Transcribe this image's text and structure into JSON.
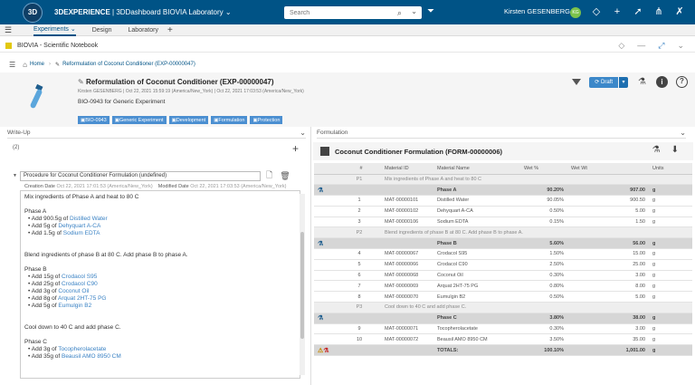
{
  "topbar": {
    "brand_bold": "3DEXPERIENCE",
    "brand_rest": " | 3DDashboard  BIOVIA Laboratory",
    "brand_chevron": "⌄",
    "search_placeholder": "Search",
    "user_name": "Kirsten GESENBERG",
    "user_initials": "KG",
    "bg_color": "#005386"
  },
  "tabs": [
    {
      "label": "Experiments ⌄",
      "active": true
    },
    {
      "label": "Design",
      "active": false
    },
    {
      "label": "Laboratory",
      "active": false
    }
  ],
  "app": {
    "name": "BIOVIA - Scientific Notebook"
  },
  "breadcrumb": {
    "home": "Home",
    "current": "Reformulation of Coconut Conditioner (EXP-00000047)"
  },
  "experiment": {
    "title": "Reformulation of Coconut Conditioner (EXP-00000047)",
    "meta": "Kirsten GESENBERG  |  Oct 22, 2021 15:59:19 (America/New_York)  |  Oct 22, 2021 17:03:53 (America/New_York)",
    "description": "BIO-0943 for Generic Experiment",
    "chips": [
      "BIO-0943",
      "Generic Experiment",
      "Development",
      "Formulation",
      "Protection"
    ],
    "status": "Draft"
  },
  "left_panel": {
    "header": "Write-Up",
    "count": "(2)",
    "procedure_title": "Procedure for Coconut Conditioner Formulation (undefined)",
    "creation_label": "Creation Date",
    "creation_value": "Oct 22, 2021 17:01:53 (America/New_York)",
    "modified_label": "Modified Date",
    "modified_value": "Oct 22, 2021 17:03:53 (America/New_York)",
    "editor": {
      "p1": "Mix ingredients of Phase A and heat to 80 C",
      "phaseA": "Phase A",
      "a_items": [
        {
          "pre": "Add 900.5g of ",
          "link": "Distilled Water"
        },
        {
          "pre": "Add 5g of ",
          "link": "Dehyquart A-CA"
        },
        {
          "pre": "Add 1.5g of ",
          "link": "Sodium EDTA"
        }
      ],
      "p2": "Blend ingredients of phase B at 80 C. Add phase B to phase A.",
      "phaseB": "Phase B",
      "b_items": [
        {
          "pre": "Add 15g of ",
          "link": "Crodacol S95"
        },
        {
          "pre": "Add 25g of ",
          "link": "Crodacol C90"
        },
        {
          "pre": "Add 3g of ",
          "link": "Coconut Oil"
        },
        {
          "pre": "Add 8g of ",
          "link": "Arquat 2HT-75 PG"
        },
        {
          "pre": "Add 5g of ",
          "link": "Eumulgin B2"
        }
      ],
      "p3": "Cool down to 40 C and add phase C.",
      "phaseC": "Phase C",
      "c_items": [
        {
          "pre": "Add 3g of ",
          "link": "Tocopherolacetate"
        },
        {
          "pre": "Add 35g of ",
          "link": "Beausil AMO 8950 CM"
        }
      ]
    }
  },
  "right_panel": {
    "header": "Formulation",
    "form_title": "Coconut Conditioner Formulation (FORM-00000006)",
    "columns": [
      "#",
      "Material ID",
      "Material Name",
      "Wet %",
      "Wet Wt",
      "Units"
    ],
    "rows": [
      {
        "kind": "step",
        "num": "P1",
        "text": "Mix ingredients of Phase A and heat to 80 C"
      },
      {
        "kind": "phase",
        "name": "Phase A",
        "pct": "90.20%",
        "wt": "907.00",
        "unit": "g"
      },
      {
        "kind": "item",
        "num": "1",
        "id": "MAT-00000101",
        "name": "Distilled Water",
        "pct": "90.05%",
        "wt": "900.50",
        "unit": "g"
      },
      {
        "kind": "item",
        "num": "2",
        "id": "MAT-00000102",
        "name": "Dehyquart A-CA",
        "pct": "0.50%",
        "wt": "5.00",
        "unit": "g"
      },
      {
        "kind": "item",
        "num": "3",
        "id": "MAT-00000106",
        "name": "Sodium EDTA",
        "pct": "0.15%",
        "wt": "1.50",
        "unit": "g"
      },
      {
        "kind": "step",
        "num": "P2",
        "text": "Blend ingredients of phase B at 80 C. Add phase B to phase A."
      },
      {
        "kind": "phase",
        "name": "Phase B",
        "pct": "5.60%",
        "wt": "56.00",
        "unit": "g"
      },
      {
        "kind": "item",
        "num": "4",
        "id": "MAT-00000067",
        "name": "Crodacol S95",
        "pct": "1.50%",
        "wt": "15.00",
        "unit": "g"
      },
      {
        "kind": "item",
        "num": "5",
        "id": "MAT-00000066",
        "name": "Crodacol C90",
        "pct": "2.50%",
        "wt": "25.00",
        "unit": "g"
      },
      {
        "kind": "item",
        "num": "6",
        "id": "MAT-00000068",
        "name": "Coconut Oil",
        "pct": "0.30%",
        "wt": "3.00",
        "unit": "g"
      },
      {
        "kind": "item",
        "num": "7",
        "id": "MAT-00000069",
        "name": "Arquat 2HT-75 PG",
        "pct": "0.80%",
        "wt": "8.00",
        "unit": "g"
      },
      {
        "kind": "item",
        "num": "8",
        "id": "MAT-00000070",
        "name": "Eumulgin B2",
        "pct": "0.50%",
        "wt": "5.00",
        "unit": "g"
      },
      {
        "kind": "step",
        "num": "P3",
        "text": "Cool down to 40 C and add phase C."
      },
      {
        "kind": "phase",
        "name": "Phase C",
        "pct": "3.80%",
        "wt": "38.00",
        "unit": "g"
      },
      {
        "kind": "item",
        "num": "9",
        "id": "MAT-00000071",
        "name": "Tocopherolacetate",
        "pct": "0.30%",
        "wt": "3.00",
        "unit": "g"
      },
      {
        "kind": "item",
        "num": "10",
        "id": "MAT-00000072",
        "name": "Beausil AMO 8950 CM",
        "pct": "3.50%",
        "wt": "35.00",
        "unit": "g"
      },
      {
        "kind": "total",
        "name": "TOTALS:",
        "pct": "100.10%",
        "wt": "1,001.00",
        "unit": "g"
      }
    ]
  }
}
